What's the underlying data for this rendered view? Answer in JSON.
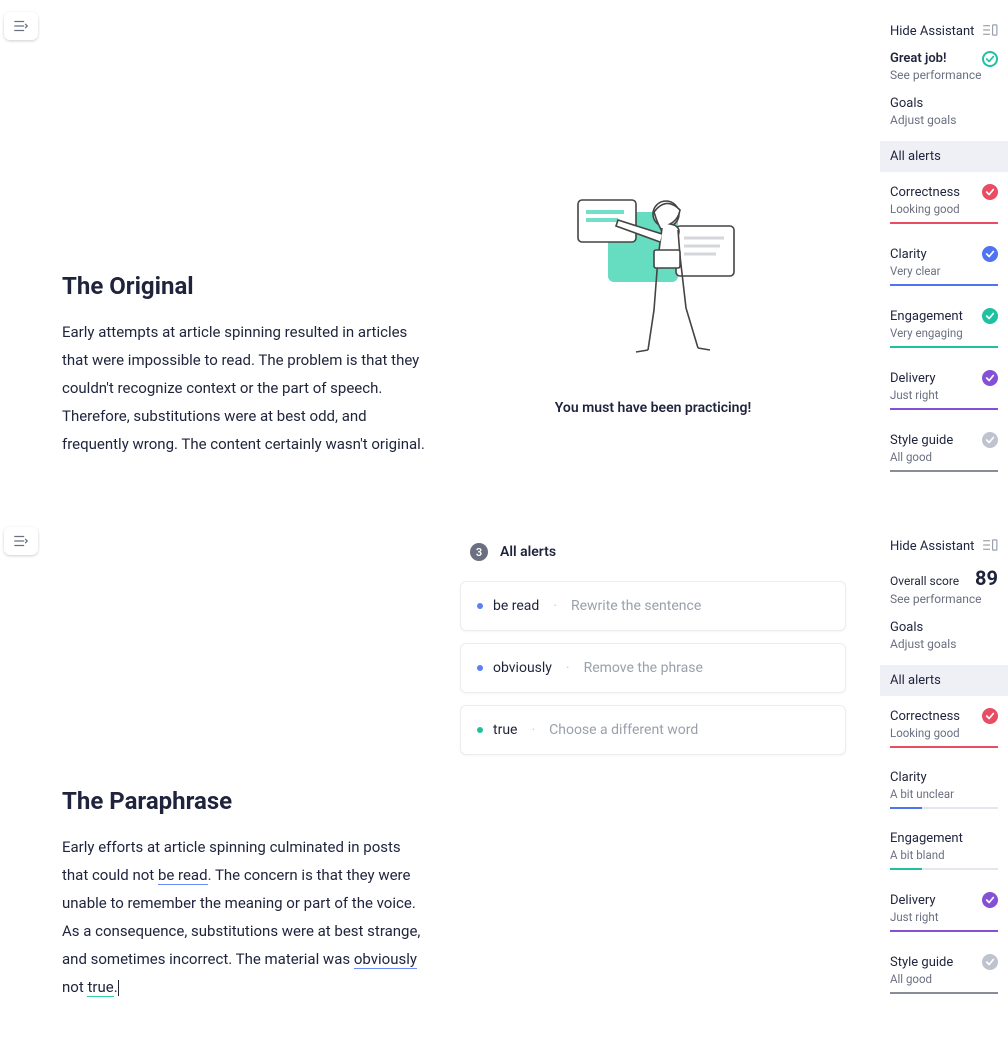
{
  "page1": {
    "title": "The Original",
    "body": "Early attempts at article spinning resulted in articles that were impossible to read. The problem is that they couldn't recognize context or the part of speech. Therefore, substitutions were at best odd, and frequently wrong. The content certainly wasn't original.",
    "illus_caption": "You must have been practicing!"
  },
  "page2": {
    "title": "The Paraphrase",
    "body_parts": {
      "p0": "Early efforts at article spinning culminated in posts that could not ",
      "u0": "be read",
      "p1": ". The concern is that they were unable to remember the meaning or part of the voice. As a consequence, substitutions were at best strange, and sometimes incorrect. The material was ",
      "u1": "obviously",
      "p2": " not ",
      "u2": "true",
      "p3": "."
    },
    "alerts_header": "All alerts",
    "alerts_count": "3",
    "alerts": [
      {
        "text": "be read",
        "hint": "Rewrite the sentence",
        "dot": "blue"
      },
      {
        "text": "obviously",
        "hint": "Remove the phrase",
        "dot": "blue"
      },
      {
        "text": "true",
        "hint": "Choose a different word",
        "dot": "teal"
      }
    ]
  },
  "panel1": {
    "hide": "Hide Assistant",
    "great": "Great job!",
    "see_perf": "See performance",
    "goals": "Goals",
    "adjust": "Adjust goals",
    "all_alerts": "All alerts",
    "cats": {
      "correctness": {
        "name": "Correctness",
        "sub": "Looking good"
      },
      "clarity": {
        "name": "Clarity",
        "sub": "Very clear"
      },
      "engagement": {
        "name": "Engagement",
        "sub": "Very engaging"
      },
      "delivery": {
        "name": "Delivery",
        "sub": "Just right"
      },
      "style": {
        "name": "Style guide",
        "sub": "All good"
      }
    }
  },
  "panel2": {
    "hide": "Hide Assistant",
    "overall_label": "Overall score",
    "overall_value": "89",
    "see_perf": "See performance",
    "goals": "Goals",
    "adjust": "Adjust goals",
    "all_alerts": "All alerts",
    "cats": {
      "correctness": {
        "name": "Correctness",
        "sub": "Looking good"
      },
      "clarity": {
        "name": "Clarity",
        "sub": "A bit unclear"
      },
      "engagement": {
        "name": "Engagement",
        "sub": "A bit bland"
      },
      "delivery": {
        "name": "Delivery",
        "sub": "Just right"
      },
      "style": {
        "name": "Style guide",
        "sub": "All good"
      }
    }
  }
}
